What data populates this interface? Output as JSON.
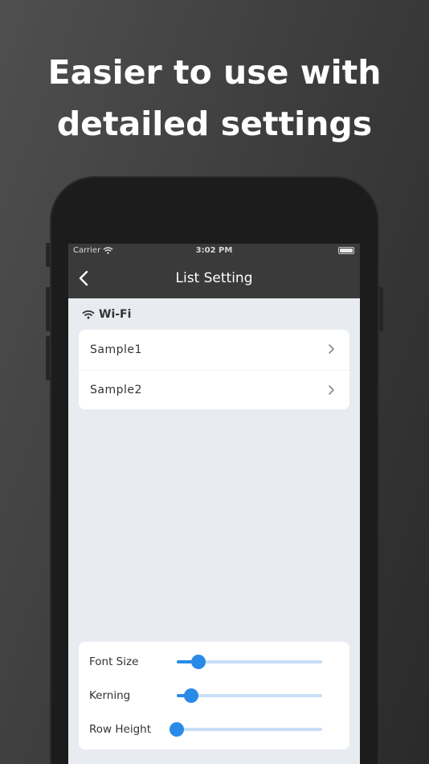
{
  "headline": {
    "line1": "Easier to use with",
    "line2": "detailed settings"
  },
  "status_bar": {
    "carrier": "Carrier",
    "time": "3:02 PM"
  },
  "nav": {
    "title": "List Setting"
  },
  "section": {
    "title": "Wi-Fi",
    "icon": "wifi-icon"
  },
  "list_items": [
    {
      "label": "Sample1"
    },
    {
      "label": "Sample2"
    }
  ],
  "sliders": [
    {
      "label": "Font Size",
      "value": 0.15
    },
    {
      "label": "Kerning",
      "value": 0.1
    },
    {
      "label": "Row Height",
      "value": 0.0
    }
  ],
  "colors": {
    "accent": "#2a8ae8",
    "track": "#c7def7",
    "nav_bg": "#3a3a3a",
    "screen_bg": "#e8ebf0"
  }
}
